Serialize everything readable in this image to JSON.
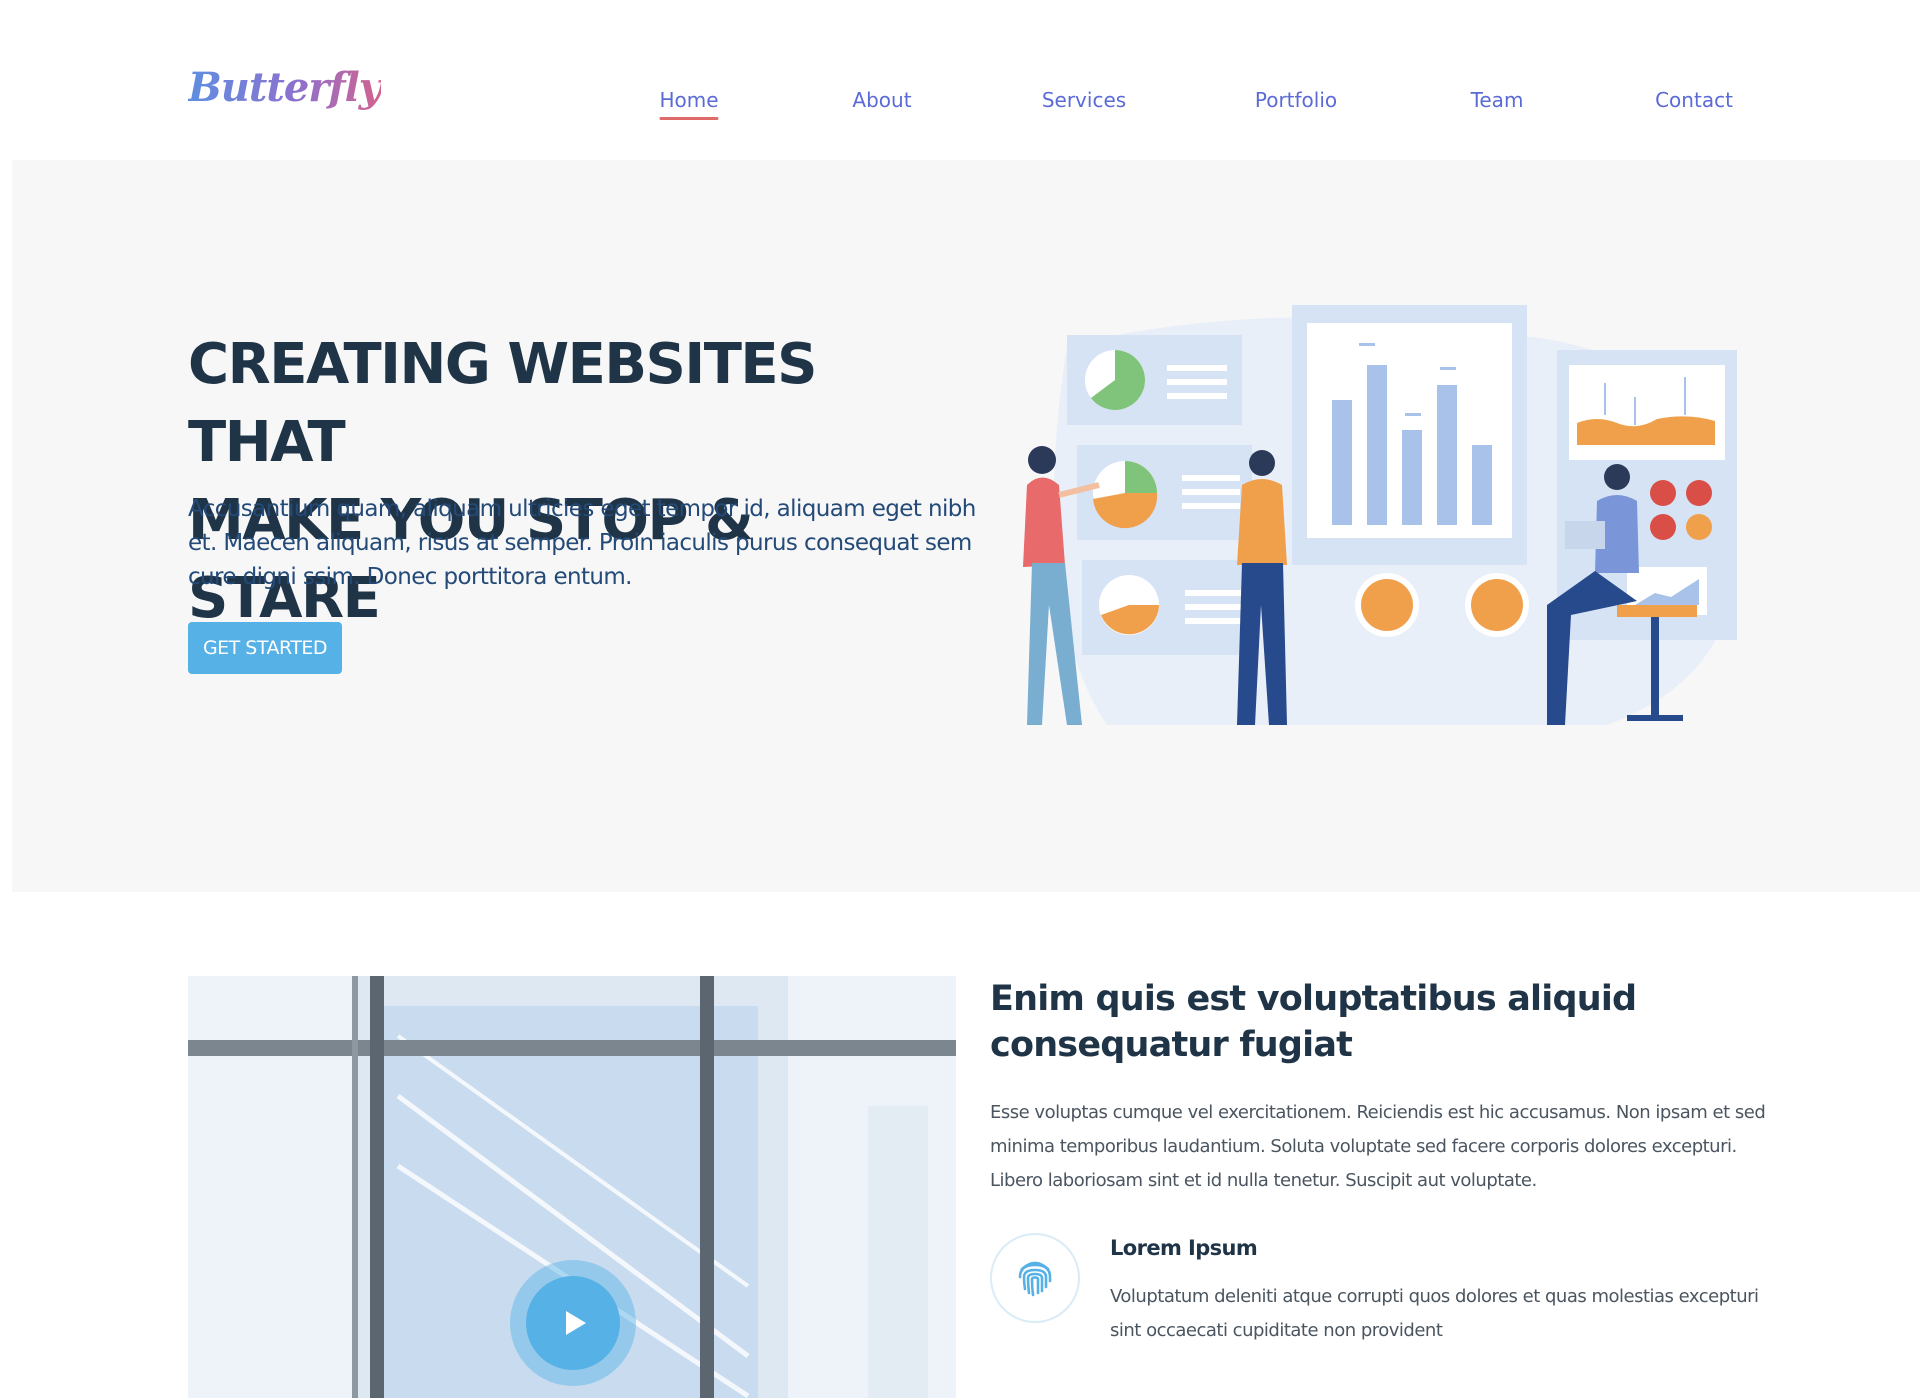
{
  "header": {
    "logo_text": "Butterfly",
    "nav": [
      {
        "label": "Home",
        "active": true
      },
      {
        "label": "About",
        "active": false
      },
      {
        "label": "Services",
        "active": false
      },
      {
        "label": "Portfolio",
        "active": false
      },
      {
        "label": "Team",
        "active": false
      },
      {
        "label": "Contact",
        "active": false
      }
    ]
  },
  "hero": {
    "title_line1": "CREATING WEBSITES THAT",
    "title_line2": "MAKE YOU STOP & STARE",
    "text": "Accusantium quam, aliquam ultricies eget tempor id, aliquam eget nibh et. Maecen aliquam, risus at semper. Proin iaculis purus consequat sem cure digni ssim. Donec porttitora entum.",
    "button_label": "GET STARTED",
    "illustration": "team-analytics-illustration"
  },
  "about": {
    "video_icon": "play-icon",
    "title": "Enim quis est voluptatibus aliquid consequatur fugiat",
    "text": "Esse voluptas cumque vel exercitationem. Reiciendis est hic accusamus. Non ipsam et sed minima temporibus laudantium. Soluta voluptate sed facere corporis dolores excepturi. Libero laboriosam sint et id nulla tenetur. Suscipit aut voluptate.",
    "feature": {
      "icon": "fingerprint-icon",
      "title": "Lorem Ipsum",
      "text": "Voluptatum deleniti atque corrupti quos dolores et quas molestias excepturi sint occaecati cupiditate non provident"
    }
  },
  "colors": {
    "accent_blue": "#56b1e6",
    "nav_link": "#5b6bd6",
    "active_underline": "#e06a6a",
    "heading": "#1f3446",
    "hero_bg": "#f7f7f8"
  }
}
